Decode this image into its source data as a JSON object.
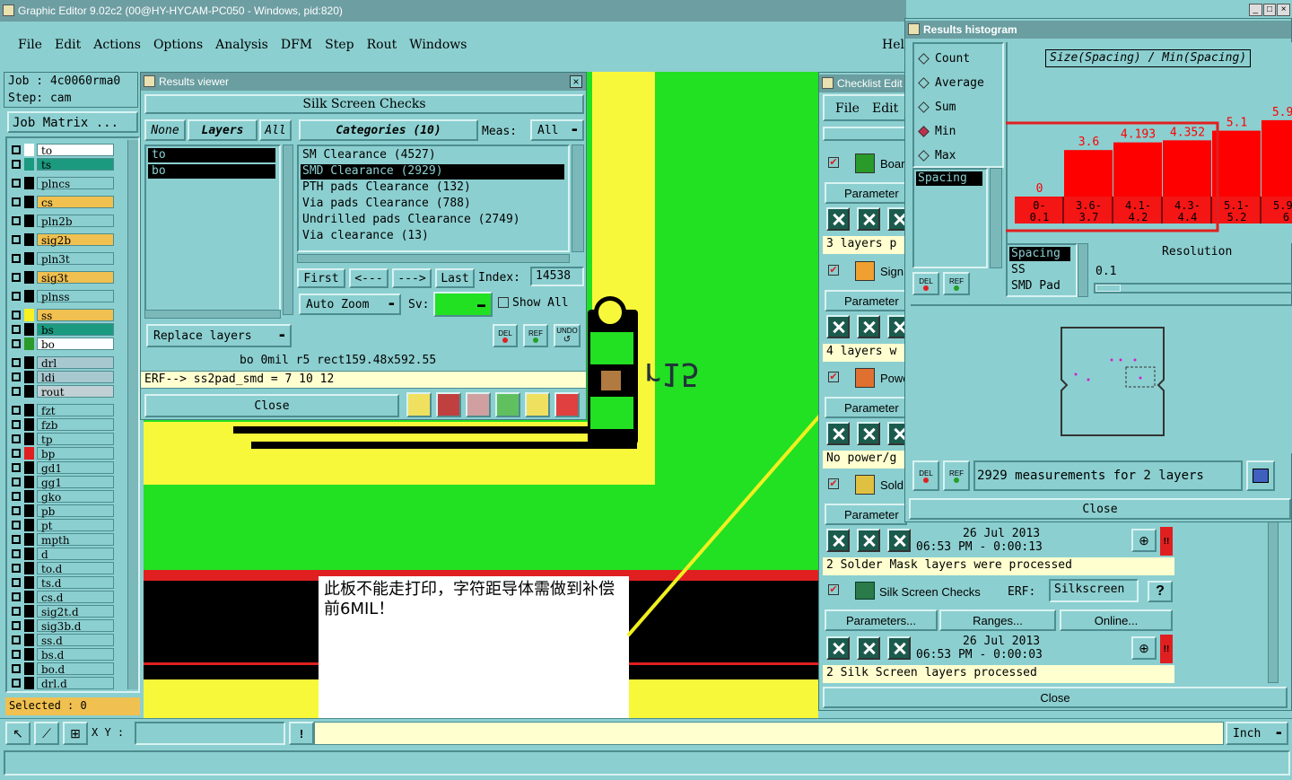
{
  "app": {
    "title": "Graphic Editor 9.02c2 (00@HY-HYCAM-PC050 - Windows, pid:820)",
    "menu": [
      "File",
      "Edit",
      "Actions",
      "Options",
      "Analysis",
      "DFM",
      "Step",
      "Rout",
      "Windows"
    ],
    "help": "Hel",
    "job_label": "Job : 4c0060rma0",
    "step_label": "Step: cam",
    "job_matrix": "Job Matrix ...",
    "selected": "Selected : 0",
    "xy_label": "X Y :",
    "units": "Inch"
  },
  "layers": [
    {
      "name": "to",
      "color": "#ffffff",
      "swatch": "#ffffff"
    },
    {
      "name": "ts",
      "color": "#1b9a80",
      "swatch": "#1b9a80"
    },
    {
      "name": "plncs",
      "color": "#8ccfd0",
      "swatch": "#000000"
    },
    {
      "name": "cs",
      "color": "#f0c050",
      "swatch": "#000000"
    },
    {
      "name": "pln2b",
      "color": "#8ccfd0",
      "swatch": "#000000"
    },
    {
      "name": "sig2b",
      "color": "#f0c050",
      "swatch": "#000000"
    },
    {
      "name": "pln3t",
      "color": "#8ccfd0",
      "swatch": "#000000"
    },
    {
      "name": "sig3t",
      "color": "#f0c050",
      "swatch": "#000000"
    },
    {
      "name": "plnss",
      "color": "#8ccfd0",
      "swatch": "#000000"
    },
    {
      "name": "ss",
      "color": "#f0c050",
      "swatch": "#f8f020"
    },
    {
      "name": "bs",
      "color": "#1b9a80",
      "swatch": "#000000"
    },
    {
      "name": "bo",
      "color": "#ffffff",
      "swatch": "#2a9a2a"
    },
    {
      "name": "drl",
      "color": "#a8c8d0",
      "swatch": "#000000"
    },
    {
      "name": "ldi",
      "color": "#a8c8d0",
      "swatch": "#000000"
    },
    {
      "name": "rout",
      "color": "#c0d0d4",
      "swatch": "#000000"
    },
    {
      "name": "fzt",
      "color": "#8ccfd0",
      "swatch": "#000000"
    },
    {
      "name": "fzb",
      "color": "#8ccfd0",
      "swatch": "#000000"
    },
    {
      "name": "tp",
      "color": "#8ccfd0",
      "swatch": "#000000"
    },
    {
      "name": "bp",
      "color": "#8ccfd0",
      "swatch": "#e02020"
    },
    {
      "name": "gd1",
      "color": "#8ccfd0",
      "swatch": "#000000"
    },
    {
      "name": "gg1",
      "color": "#8ccfd0",
      "swatch": "#000000"
    },
    {
      "name": "gko",
      "color": "#8ccfd0",
      "swatch": "#000000"
    },
    {
      "name": "pb",
      "color": "#8ccfd0",
      "swatch": "#000000"
    },
    {
      "name": "pt",
      "color": "#8ccfd0",
      "swatch": "#000000"
    },
    {
      "name": "mpth",
      "color": "#8ccfd0",
      "swatch": "#000000"
    },
    {
      "name": "d",
      "color": "#8ccfd0",
      "swatch": "#000000"
    },
    {
      "name": "to.d",
      "color": "#8ccfd0",
      "swatch": "#000000"
    },
    {
      "name": "ts.d",
      "color": "#8ccfd0",
      "swatch": "#000000"
    },
    {
      "name": "cs.d",
      "color": "#8ccfd0",
      "swatch": "#000000"
    },
    {
      "name": "sig2t.d",
      "color": "#8ccfd0",
      "swatch": "#000000"
    },
    {
      "name": "sig3b.d",
      "color": "#8ccfd0",
      "swatch": "#000000"
    },
    {
      "name": "ss.d",
      "color": "#8ccfd0",
      "swatch": "#000000"
    },
    {
      "name": "bs.d",
      "color": "#8ccfd0",
      "swatch": "#000000"
    },
    {
      "name": "bo.d",
      "color": "#8ccfd0",
      "swatch": "#000000"
    },
    {
      "name": "drl.d",
      "color": "#8ccfd0",
      "swatch": "#000000"
    }
  ],
  "results_viewer": {
    "title": "Results viewer",
    "header": "Silk Screen Checks",
    "none": "None",
    "layers_label": "Layers",
    "all": "All",
    "layer_list": [
      "to",
      "bo"
    ],
    "categories_label": "Categories (10)",
    "meas_label": "Meas:",
    "meas_value": "All",
    "categories": [
      "SM Clearance (4527)",
      "SMD Clearance (2929)",
      "PTH pads Clearance (132)",
      "Via pads Clearance (788)",
      "Undrilled pads Clearance (2749)",
      "Via clearance (13)"
    ],
    "selected_category": "SMD Clearance (2929)",
    "first": "First",
    "prev": "<---",
    "next": "--->",
    "last": "Last",
    "index_label": "Index:",
    "index_value": "14538",
    "auto_zoom": "Auto Zoom",
    "sv_label": "Sv:",
    "show_all": "Show All",
    "replace_layers": "Replace layers",
    "del": "DEL",
    "ref": "REF",
    "undo": "UNDO",
    "status_line": "bo 0mil r5 rect159.48x592.55",
    "erf_line": "ERF--> ss2pad_smd = 7 10 12",
    "close": "Close"
  },
  "annotation": {
    "text": "此板不能走打印，字符距导体需做到补偿前6MIL！",
    "canvas_text": "r15"
  },
  "checklist": {
    "title": "Checklist Edit",
    "menu": [
      "File",
      "Edit"
    ],
    "items": [
      {
        "name": "Boar",
        "row_text": "3 layers p"
      },
      {
        "name": "Sign",
        "row_text": "4 layers w"
      },
      {
        "name": "Powe",
        "row_text": "No power/g"
      },
      {
        "name": "Sold",
        "row_text": ""
      }
    ],
    "parameters": "Parameter",
    "sold_date": "26 Jul 2013",
    "sold_time": "06:53 PM - 0:00:13",
    "sold_status": "2 Solder Mask layers were processed",
    "silk_name": "Silk Screen Checks",
    "erf_label": "ERF:",
    "erf_value": "Silkscreen",
    "help_q": "?",
    "parameters_full": "Parameters...",
    "ranges": "Ranges...",
    "online": "Online...",
    "silk_date": "26 Jul 2013",
    "silk_time": "06:53 PM - 0:00:03",
    "silk_status": "2 Silk Screen layers processed",
    "alert": "!!",
    "close": "Close"
  },
  "histogram": {
    "title": "Results histogram",
    "modes": [
      "Count",
      "Average",
      "Sum",
      "Min",
      "Max"
    ],
    "selected_mode": "Min",
    "left_list": [
      "Spacing"
    ],
    "chart_title": "Size(Spacing) / Min(Spacing)",
    "res_list": [
      "Spacing",
      "SS",
      "SMD Pad"
    ],
    "resolution_label": "Resolution",
    "resolution_value": "0.1",
    "del": "DEL",
    "ref": "REF",
    "summary": "2929 measurements for 2 layers",
    "close": "Close"
  },
  "chart_data": {
    "type": "bar",
    "title": "Size(Spacing) / Min(Spacing)",
    "categories": [
      "0-\n0.1",
      "3.6-\n3.7",
      "4.1-\n4.2",
      "4.3-\n4.4",
      "5.1-\n5.2",
      "5.9-\n6"
    ],
    "values": [
      0,
      3.6,
      4.193,
      4.352,
      5.1,
      5.91
    ],
    "labels": [
      "0",
      "3.6",
      "4.193",
      "4.352",
      "5.1",
      "5.91"
    ],
    "ylim": [
      0,
      7
    ],
    "bar_color": "#ff0000",
    "label_color": "#ff0000",
    "legend": "none"
  },
  "colors": {
    "teal": "#8ccfd0",
    "pcb_green": "#22e022",
    "pcb_yellow": "#f8f83a",
    "highlight_red": "#e02020"
  }
}
